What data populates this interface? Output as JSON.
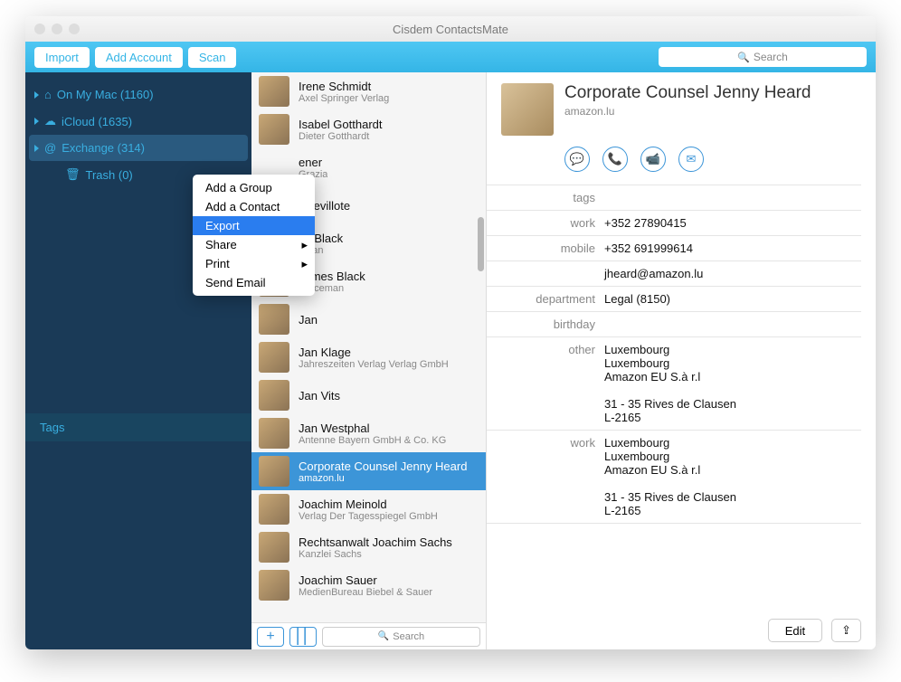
{
  "app_title": "Cisdem ContactsMate",
  "toolbar": {
    "import": "Import",
    "add_account": "Add Account",
    "scan": "Scan",
    "search_placeholder": "Search"
  },
  "sidebar": {
    "items": [
      {
        "label": "On My Mac (1160)"
      },
      {
        "label": "iCloud (1635)"
      },
      {
        "label": "Exchange (314)"
      },
      {
        "label": "Trash (0)"
      }
    ],
    "tags_header": "Tags"
  },
  "context_menu": {
    "items": [
      {
        "label": "Add a Group",
        "submenu": false
      },
      {
        "label": "Add a Contact",
        "submenu": false
      },
      {
        "label": "Export",
        "submenu": false,
        "highlight": true
      },
      {
        "label": "Share",
        "submenu": true
      },
      {
        "label": "Print",
        "submenu": true
      },
      {
        "label": "Send Email",
        "submenu": false
      }
    ]
  },
  "contacts": [
    {
      "name": "Irene Schmidt",
      "sub": "Axel Springer Verlag",
      "av": "av1"
    },
    {
      "name": "Isabel Gotthardt",
      "sub": "Dieter Gotthardt",
      "av": "av2"
    },
    {
      "name": "ener",
      "sub": "Grazia",
      "av": "av3",
      "truncated": true
    },
    {
      "name": "Chevillote",
      "sub": "",
      "av": "av4",
      "truncated": true
    },
    {
      "name": "es Black",
      "sub": "eman",
      "av": "av5",
      "truncated": true
    },
    {
      "name": "James Black",
      "sub": "policeman",
      "av": "av6"
    },
    {
      "name": "Jan",
      "sub": "",
      "av": "av5"
    },
    {
      "name": "Jan Klage",
      "sub": "Jahreszeiten Verlag Verlag GmbH",
      "av": "av7"
    },
    {
      "name": "Jan Vits",
      "sub": "",
      "av": "av5"
    },
    {
      "name": "Jan Westphal",
      "sub": "Antenne Bayern GmbH & Co. KG",
      "av": "av8"
    },
    {
      "name": "Corporate Counsel Jenny Heard",
      "sub": "amazon.lu",
      "av": "av9",
      "selected": true
    },
    {
      "name": "Joachim Meinold",
      "sub": "Verlag Der Tagesspiegel GmbH",
      "av": "av1"
    },
    {
      "name": "Rechtsanwalt Joachim Sachs",
      "sub": "Kanzlei Sachs",
      "av": "av6"
    },
    {
      "name": "Joachim Sauer",
      "sub": "MedienBureau Biebel & Sauer",
      "av": "av2"
    }
  ],
  "mid_footer": {
    "search_placeholder": "Search"
  },
  "detail": {
    "name": "Corporate Counsel Jenny Heard",
    "company": "amazon.lu",
    "fields": [
      {
        "label": "tags",
        "value": ""
      },
      {
        "label": "work",
        "value": "+352 27890415"
      },
      {
        "label": "mobile",
        "value": "+352 691999614"
      },
      {
        "label": "",
        "value": "jheard@amazon.lu"
      },
      {
        "label": "department",
        "value": "Legal (8150)"
      },
      {
        "label": "birthday",
        "value": ""
      },
      {
        "label": "other",
        "value": "Luxembourg\nLuxembourg\nAmazon EU S.à r.l\n\n31 - 35 Rives de Clausen\nL-2165"
      },
      {
        "label": "work",
        "value": "Luxembourg\nLuxembourg\nAmazon EU S.à r.l\n\n31 - 35 Rives de Clausen\nL-2165"
      }
    ],
    "edit_label": "Edit"
  }
}
